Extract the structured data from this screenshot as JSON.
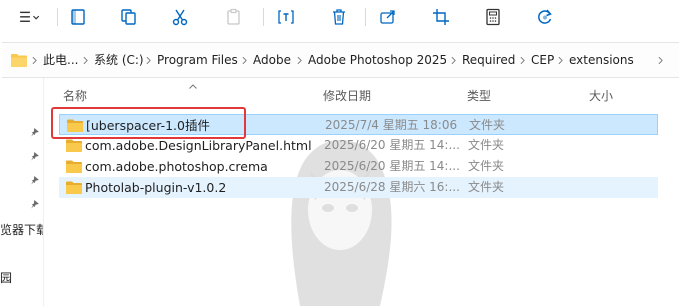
{
  "toolbar": {
    "buttons": [
      {
        "name": "view-menu-icon",
        "icon": "menu-icon"
      },
      {
        "name": "details-pane-icon",
        "icon": "pane-icon"
      },
      {
        "name": "copy-icon",
        "icon": "copy-icon"
      },
      {
        "name": "cut-icon",
        "icon": "scissors-icon"
      },
      {
        "name": "paste-icon",
        "icon": "paste-icon"
      },
      {
        "name": "rename-icon",
        "icon": "rename-icon"
      },
      {
        "name": "delete-icon",
        "icon": "trash-icon"
      },
      {
        "name": "share-icon",
        "icon": "share-icon"
      },
      {
        "name": "crop-icon",
        "icon": "crop-icon"
      },
      {
        "name": "properties-icon",
        "icon": "calculator-icon"
      },
      {
        "name": "refresh-icon",
        "icon": "refresh-icon"
      }
    ]
  },
  "address": {
    "segments": [
      "此电...",
      "系统 (C:)",
      "Program Files",
      "Adobe",
      "Adobe Photoshop 2025",
      "Required",
      "CEP",
      "extensions"
    ]
  },
  "nav": {
    "labels": [
      "览器下载",
      "园"
    ]
  },
  "columns": {
    "name": "名称",
    "date": "修改日期",
    "type": "类型",
    "size": "大小"
  },
  "files": [
    {
      "name": "[uberspacer-1.0插件",
      "date": "2025/7/4 星期五 18:06",
      "type": "文件夹",
      "state": "selected"
    },
    {
      "name": "com.adobe.DesignLibraryPanel.html",
      "date": "2025/6/20 星期五 14:...",
      "type": "文件夹",
      "state": "normal"
    },
    {
      "name": "com.adobe.photoshop.crema",
      "date": "2025/6/20 星期五 14:...",
      "type": "文件夹",
      "state": "normal"
    },
    {
      "name": "Photolab-plugin-v1.0.2",
      "date": "2025/6/28 星期六 16:...",
      "type": "文件夹",
      "state": "hover"
    }
  ],
  "colors": {
    "accent": "#0067c0",
    "selection": "#cce8ff",
    "highlight": "#e0393a",
    "folder": "#f8c94b"
  }
}
